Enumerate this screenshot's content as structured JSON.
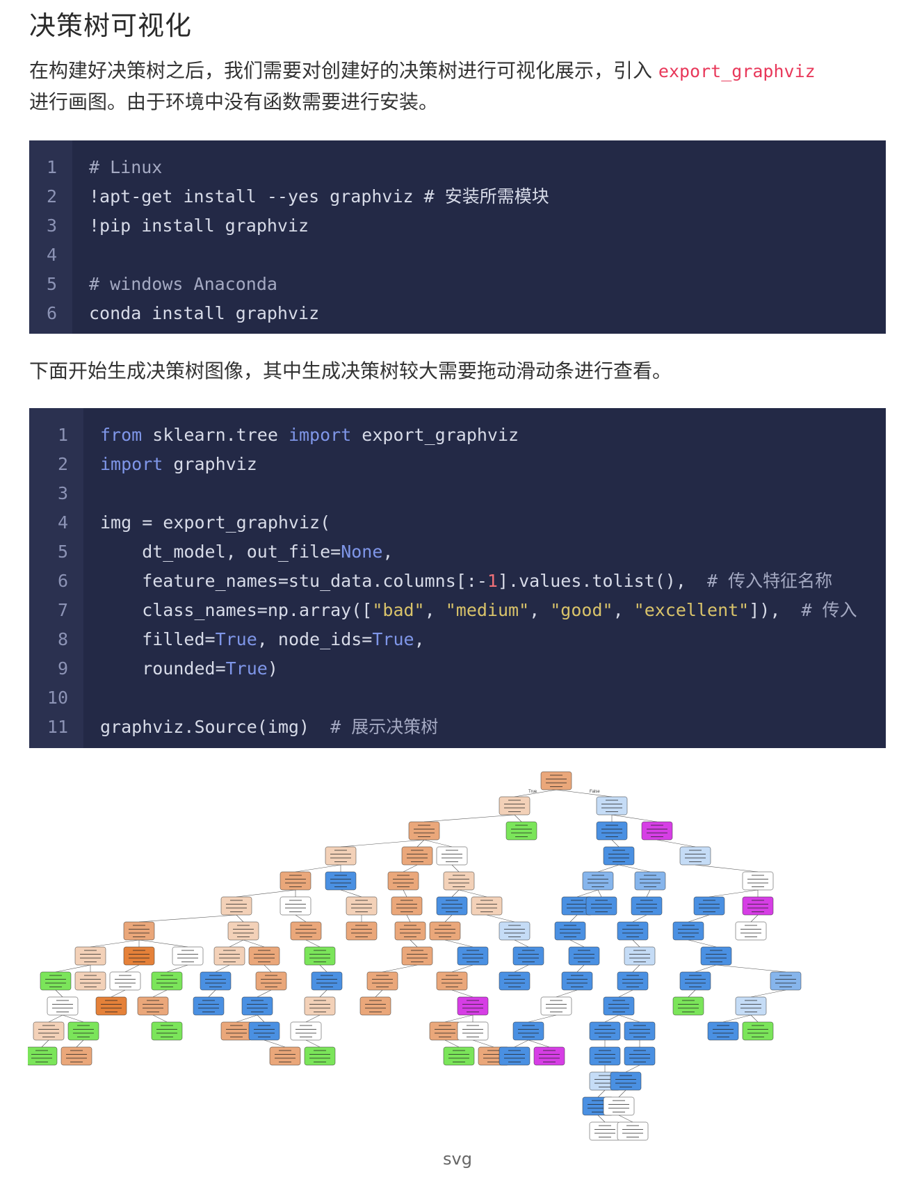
{
  "title": "决策树可视化",
  "intro": {
    "text_before": "在构建好决策树之后，我们需要对创建好的决策树进行可视化展示，引入 ",
    "inline_code": "export_graphviz",
    "text_after": "进行画图。由于环境中没有函数需要进行安装。"
  },
  "code_block_1": {
    "line_numbers": [
      "1",
      "2",
      "3",
      "4",
      "5",
      "6"
    ],
    "lines": [
      "# Linux",
      "!apt-get install --yes graphviz # 安装所需模块",
      "!pip install graphviz",
      "",
      "# windows Anaconda",
      "conda install graphviz"
    ]
  },
  "paragraph_2": "下面开始生成决策树图像，其中生成决策树较大需要拖动滑动条进行查看。",
  "code_block_2": {
    "line_numbers": [
      "1",
      "2",
      "3",
      "4",
      "5",
      "6",
      "7",
      "8",
      "9",
      "10",
      "11"
    ],
    "lines": [
      "from sklearn.tree import export_graphviz",
      "import graphviz",
      "",
      "img = export_graphviz(",
      "    dt_model, out_file=None,",
      "    feature_names=stu_data.columns[:-1].values.tolist(),  # 传入特征名称",
      "    class_names=np.array([\"bad\", \"medium\", \"good\", \"excellent\"]),  # 传入",
      "    filled=True, node_ids=True,",
      "    rounded=True)",
      "",
      "graphviz.Source(img)  # 展示决策树"
    ]
  },
  "tree_image": {
    "edge_labels": [
      "True",
      "False"
    ],
    "class_colors": {
      "bad": "#e58139",
      "medium": "#7be55a",
      "good": "#4a90e2",
      "excellent": "#d63ee5"
    }
  },
  "caption": "svg"
}
